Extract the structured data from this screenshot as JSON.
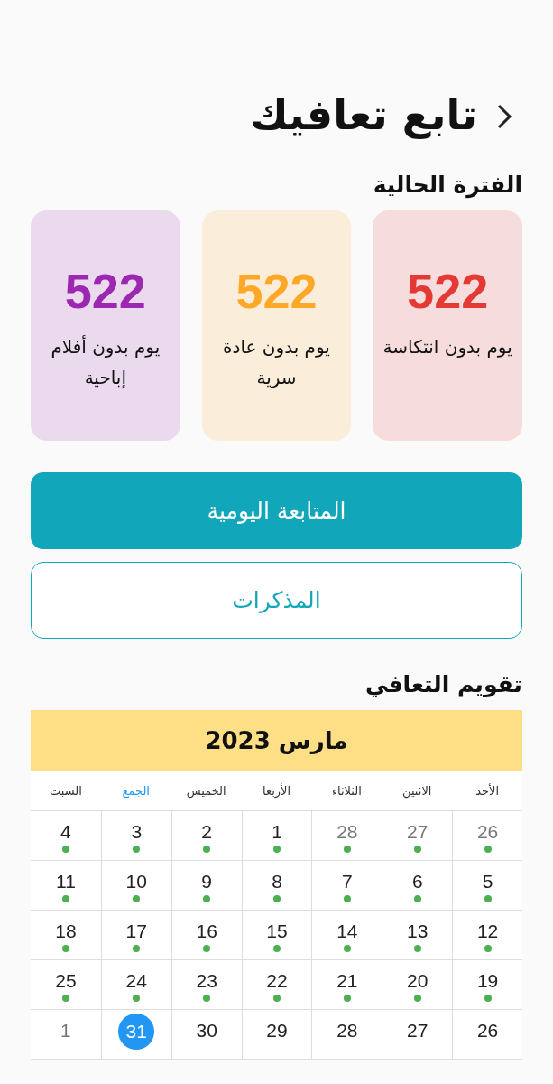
{
  "header": {
    "title": "تابع تعافيك"
  },
  "current_period": {
    "heading": "الفترة الحالية",
    "cards": [
      {
        "count": "522",
        "label": "يوم بدون انتكاسة",
        "color": "#e53935"
      },
      {
        "count": "522",
        "label": "يوم بدون عادة سرية",
        "color": "#ffa726"
      },
      {
        "count": "522",
        "label": "يوم بدون أفلام إباحية",
        "color": "#9c27b0"
      }
    ]
  },
  "buttons": [
    {
      "label": "المتابعة اليومية",
      "kind": "filled"
    },
    {
      "label": "المذكرات",
      "kind": "outline"
    }
  ],
  "calendar": {
    "heading": "تقويم التعافي",
    "month": "مارس 2023",
    "weekdays": [
      {
        "label": "الأحد",
        "today": false
      },
      {
        "label": "الاثنين",
        "today": false
      },
      {
        "label": "الثلاثاء",
        "today": false
      },
      {
        "label": "الأربعا",
        "today": false
      },
      {
        "label": "الخميس",
        "today": false
      },
      {
        "label": "الجمع",
        "today": true
      },
      {
        "label": "السبت",
        "today": false
      }
    ],
    "weeks": [
      [
        {
          "day": "26",
          "muted": true,
          "dot": true,
          "selected": false
        },
        {
          "day": "27",
          "muted": true,
          "dot": true,
          "selected": false
        },
        {
          "day": "28",
          "muted": true,
          "dot": true,
          "selected": false
        },
        {
          "day": "1",
          "muted": false,
          "dot": true,
          "selected": false
        },
        {
          "day": "2",
          "muted": false,
          "dot": true,
          "selected": false
        },
        {
          "day": "3",
          "muted": false,
          "dot": true,
          "selected": false
        },
        {
          "day": "4",
          "muted": false,
          "dot": true,
          "selected": false
        }
      ],
      [
        {
          "day": "5",
          "muted": false,
          "dot": true,
          "selected": false
        },
        {
          "day": "6",
          "muted": false,
          "dot": true,
          "selected": false
        },
        {
          "day": "7",
          "muted": false,
          "dot": true,
          "selected": false
        },
        {
          "day": "8",
          "muted": false,
          "dot": true,
          "selected": false
        },
        {
          "day": "9",
          "muted": false,
          "dot": true,
          "selected": false
        },
        {
          "day": "10",
          "muted": false,
          "dot": true,
          "selected": false
        },
        {
          "day": "11",
          "muted": false,
          "dot": true,
          "selected": false
        }
      ],
      [
        {
          "day": "12",
          "muted": false,
          "dot": true,
          "selected": false
        },
        {
          "day": "13",
          "muted": false,
          "dot": true,
          "selected": false
        },
        {
          "day": "14",
          "muted": false,
          "dot": true,
          "selected": false
        },
        {
          "day": "15",
          "muted": false,
          "dot": true,
          "selected": false
        },
        {
          "day": "16",
          "muted": false,
          "dot": true,
          "selected": false
        },
        {
          "day": "17",
          "muted": false,
          "dot": true,
          "selected": false
        },
        {
          "day": "18",
          "muted": false,
          "dot": true,
          "selected": false
        }
      ],
      [
        {
          "day": "19",
          "muted": false,
          "dot": true,
          "selected": false
        },
        {
          "day": "20",
          "muted": false,
          "dot": true,
          "selected": false
        },
        {
          "day": "21",
          "muted": false,
          "dot": true,
          "selected": false
        },
        {
          "day": "22",
          "muted": false,
          "dot": true,
          "selected": false
        },
        {
          "day": "23",
          "muted": false,
          "dot": true,
          "selected": false
        },
        {
          "day": "24",
          "muted": false,
          "dot": true,
          "selected": false
        },
        {
          "day": "25",
          "muted": false,
          "dot": true,
          "selected": false
        }
      ],
      [
        {
          "day": "26",
          "muted": false,
          "dot": false,
          "selected": false
        },
        {
          "day": "27",
          "muted": false,
          "dot": false,
          "selected": false
        },
        {
          "day": "28",
          "muted": false,
          "dot": false,
          "selected": false
        },
        {
          "day": "29",
          "muted": false,
          "dot": false,
          "selected": false
        },
        {
          "day": "30",
          "muted": false,
          "dot": false,
          "selected": false
        },
        {
          "day": "31",
          "muted": false,
          "dot": false,
          "selected": true
        },
        {
          "day": "1",
          "muted": true,
          "dot": false,
          "selected": false
        }
      ]
    ]
  }
}
